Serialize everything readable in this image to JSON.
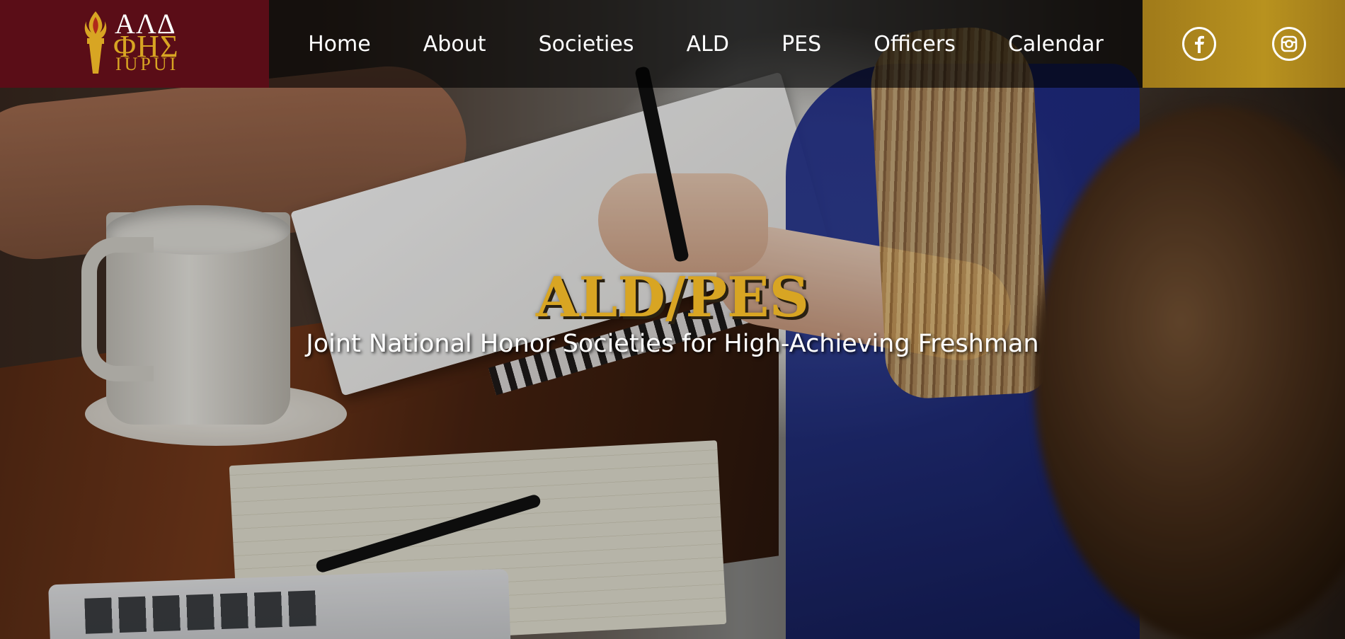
{
  "header": {
    "logo": {
      "line1": "ΑΛΔ",
      "line2": "ΦΗΣ",
      "line3": "IUPUI"
    },
    "nav": [
      {
        "label": "Home"
      },
      {
        "label": "About"
      },
      {
        "label": "Societies"
      },
      {
        "label": "ALD"
      },
      {
        "label": "PES"
      },
      {
        "label": "Officers"
      },
      {
        "label": "Calendar"
      }
    ],
    "social": [
      {
        "icon": "facebook-icon"
      },
      {
        "icon": "instagram-icon"
      }
    ]
  },
  "hero": {
    "title": "ALD/PES",
    "subtitle": "Joint National Honor Societies for High-Achieving Freshman"
  },
  "colors": {
    "maroon": "#5a0d17",
    "gold": "#d8a523",
    "nav_bg": "rgba(0,0,0,0.62)",
    "social_bg": "#b8921f"
  }
}
